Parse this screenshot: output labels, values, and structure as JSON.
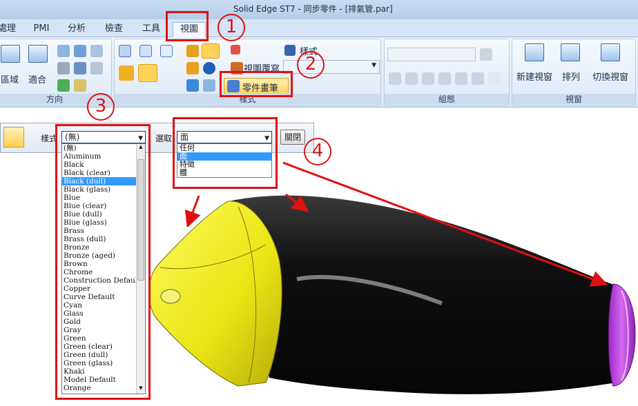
{
  "window": {
    "title": "Solid Edge ST7 - 同步零件 - [排氣管.par]"
  },
  "tabs": [
    "處理",
    "PMI",
    "分析",
    "檢查",
    "工具",
    "視圖"
  ],
  "ribbon": {
    "view_group": {
      "label_area": "區域",
      "label_fit": "適合",
      "group_label": "方向"
    },
    "style_group": {
      "style_label": "樣式",
      "view_override": "視圖覆寫",
      "part_painter": "零件畫筆",
      "group_label": "樣式"
    },
    "assembly_group": {
      "group_label": "組態"
    },
    "window_group": {
      "new_window": "新建視窗",
      "arrange": "排列",
      "switch_window": "切換視窗",
      "group_label": "視窗"
    }
  },
  "command_bar": {
    "style_label": "樣式",
    "style_value": "(無)",
    "select_label": "選取：",
    "select_value": "面",
    "close_button": "關閉"
  },
  "style_list": [
    "(無)",
    "Aluminum",
    "Black",
    "Black (clear)",
    "Black (dull)",
    "Black (glass)",
    "Blue",
    "Blue (clear)",
    "Blue (dull)",
    "Blue (glass)",
    "Brass",
    "Brass (dull)",
    "Bronze",
    "Bronze (aged)",
    "Brown",
    "Chrome",
    "Construction Default",
    "Copper",
    "Curve Default",
    "Cyan",
    "Glass",
    "Gold",
    "Gray",
    "Green",
    "Green (clear)",
    "Green (dull)",
    "Green (glass)",
    "Khaki",
    "Model Default",
    "Orange"
  ],
  "style_list_selected_index": 4,
  "select_options": [
    "任何",
    "面",
    "特徵",
    "體"
  ],
  "select_options_selected_index": 1,
  "annotations": [
    "1",
    "2",
    "3",
    "4"
  ],
  "colors": {
    "annotation_red": "#e01010",
    "selection_blue": "#3399ff",
    "yellow_cone": "#f2ee1a",
    "black_body": "#0b0b0b",
    "purple_flange": "#b536d6"
  }
}
